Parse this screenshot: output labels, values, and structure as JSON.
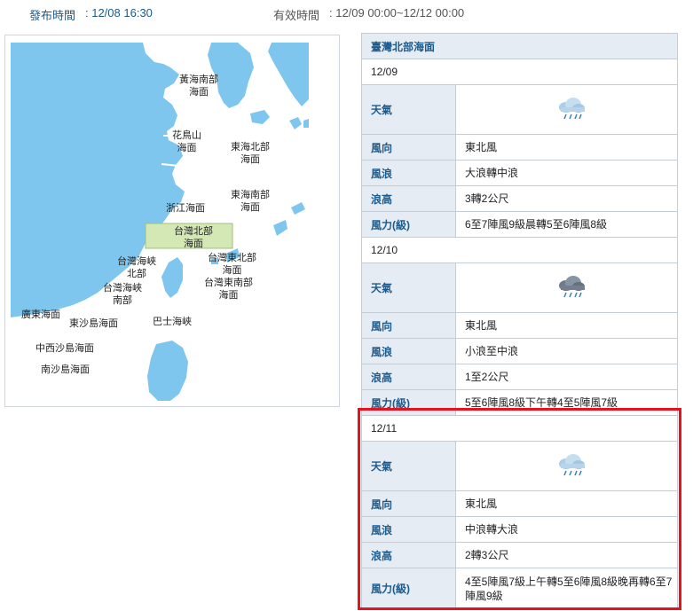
{
  "header": {
    "published_label": "發布時間",
    "published_value": ": 12/08 16:30",
    "valid_label": "有效時間",
    "valid_value": ": 12/09 00:00~12/12 00:00"
  },
  "map": {
    "labels": {
      "yellow_sea_south": "黃海南部\n海面",
      "huaniaoshan": "花鳥山\n海面",
      "east_china_sea_north": "東海北部\n海面",
      "zhejiang": "浙江海面",
      "east_china_sea_south": "東海南部\n海面",
      "taiwan_north": "台灣北部\n海面",
      "taiwan_strait_north": "台灣海峽\n北部",
      "taiwan_northeast": "台灣東北部\n海面",
      "taiwan_strait_south": "台灣海峽\n南部",
      "taiwan_southeast": "台灣東南部\n海面",
      "guangdong": "廣東海面",
      "dongsha": "東沙島海面",
      "bashi": "巴士海峽",
      "central_west_sha": "中西沙島海面",
      "nansha": "南沙島海面"
    }
  },
  "forecast": {
    "region": "臺灣北部海面",
    "labels": {
      "weather": "天氣",
      "wind_dir": "風向",
      "wave": "風浪",
      "wave_height": "浪高",
      "wind_force": "風力(級)"
    },
    "days": [
      {
        "date": "12/09",
        "weather_icon": "cloud-rain-icon",
        "wind_dir": "東北風",
        "wave": "大浪轉中浪",
        "wave_height": "3轉2公尺",
        "wind_force": "6至7陣風9級晨轉5至6陣風8級"
      },
      {
        "date": "12/10",
        "weather_icon": "dark-cloud-rain-icon",
        "wind_dir": "東北風",
        "wave": "小浪至中浪",
        "wave_height": "1至2公尺",
        "wind_force": "5至6陣風8級下午轉4至5陣風7級"
      },
      {
        "date": "12/11",
        "weather_icon": "cloud-rain-icon",
        "wind_dir": "東北風",
        "wave": "中浪轉大浪",
        "wave_height": "2轉3公尺",
        "wind_force": "4至5陣風7級上午轉5至6陣風8級晚再轉6至7陣風9級"
      }
    ]
  },
  "colors": {
    "sea": "#7ec6ee",
    "land": "#ffffff",
    "highlight_region": "#d3e8b5",
    "header_cell": "#e6ecf3",
    "label_text": "#1c5a8c",
    "highlight_border": "#e8121f"
  }
}
